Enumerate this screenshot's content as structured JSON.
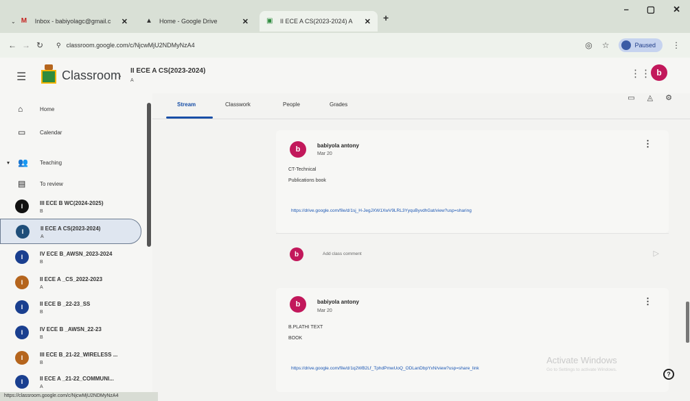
{
  "browser": {
    "tabs": [
      {
        "label": "Inbox - babiyolagc@gmail.c",
        "fav": "M"
      },
      {
        "label": "Home - Google Drive",
        "fav": "▲"
      },
      {
        "label": "II ECE A CS(2023-2024) A",
        "fav": "▣"
      }
    ],
    "new_tab": "+",
    "window_controls": {
      "minimize": "–",
      "maximize": "▢",
      "close": "✕"
    },
    "url": "classroom.google.com/c/NjcwMjU2NDMyNzA4",
    "profile_status": "Paused"
  },
  "header": {
    "app_name": "Classroom",
    "breadcrumb_sep": "›",
    "course_title": "II ECE A CS(2023-2024)",
    "course_section": "A",
    "avatar_letter": "b"
  },
  "sidebar": {
    "items": [
      {
        "label": "Home",
        "icon": "⌂"
      },
      {
        "label": "Calendar",
        "icon": "▭"
      },
      {
        "label": "Teaching",
        "icon": "👥"
      },
      {
        "label": "To review",
        "icon": "▤"
      }
    ],
    "courses": [
      {
        "name": "III ECE B WC(2024-2025)",
        "sub": "B",
        "color": "#111111"
      },
      {
        "name": "II ECE A CS(2023-2024)",
        "sub": "A",
        "color": "#1f4e79"
      },
      {
        "name": "IV ECE B_AWSN_2023-2024",
        "sub": "B",
        "color": "#1a3f8f"
      },
      {
        "name": "II ECE A _CS_2022-2023",
        "sub": "A",
        "color": "#b5651d"
      },
      {
        "name": "II ECE B _22-23_SS",
        "sub": "B",
        "color": "#1a3f8f"
      },
      {
        "name": "IV ECE B _AWSN_22-23",
        "sub": "B",
        "color": "#1a3f8f"
      },
      {
        "name": "III ECE B_21-22_WIRELESS ...",
        "sub": "B",
        "color": "#b5651d"
      },
      {
        "name": "II ECE A _21-22_COMMUNI...",
        "sub": "A",
        "color": "#1a3f8f"
      }
    ]
  },
  "status_url": "https://classroom.google.com/c/NjcwMjU2NDMyNzA4",
  "stream_tabs": [
    "Stream",
    "Classwork",
    "People",
    "Grades"
  ],
  "posts": [
    {
      "author": "babiyola antony",
      "date": "Mar 20",
      "lines": [
        "CT-Technical",
        "Publications book"
      ],
      "link": "https://drive.google.com/file/d/1sj_H-JegJXW1XwV9LRL3YyquByvdhGat/view?usp=sharing",
      "avatar": "b"
    },
    {
      "author": "babiyola antony",
      "date": "Mar 20",
      "lines": [
        "B.PLATHI TEXT",
        "BOOK"
      ],
      "link": "https://drive.google.com/file/d/1q2WB2Lf_TphdPmwUoQ_ODLanDbpYxN/view?usp=share_link",
      "avatar": "b"
    }
  ],
  "comment": {
    "placeholder": "Add class comment",
    "avatar": "b"
  },
  "watermark": {
    "title": "Activate Windows",
    "sub": "Go to Settings to activate Windows."
  },
  "colors": {
    "accent": "#174ea6",
    "avatar": "#c2185b"
  }
}
